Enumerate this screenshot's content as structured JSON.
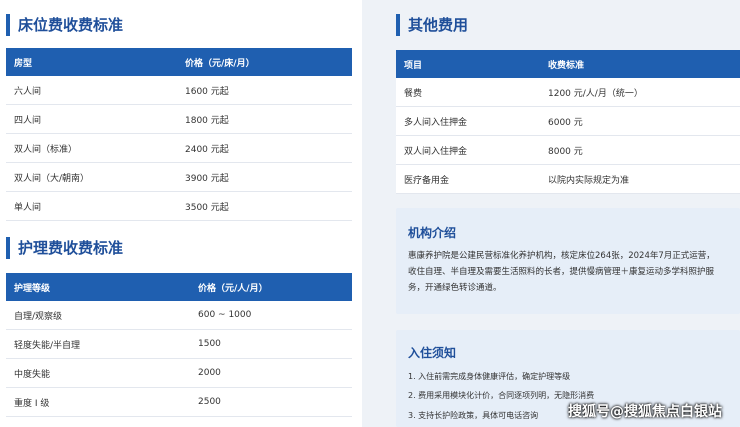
{
  "bed": {
    "title": "床位费收费标准",
    "headers": [
      "房型",
      "价格（元/床/月）"
    ],
    "rows": [
      [
        "六人间",
        "1600 元起"
      ],
      [
        "四人间",
        "1800 元起"
      ],
      [
        "双人间（标准）",
        "2400 元起"
      ],
      [
        "双人间（大/朝南）",
        "3900 元起"
      ],
      [
        "单人间",
        "3500 元起"
      ]
    ]
  },
  "care": {
    "title": "护理费收费标准",
    "headers": [
      "护理等级",
      "价格（元/人/月）"
    ],
    "rows": [
      [
        "自理/观察级",
        "600 ~ 1000"
      ],
      [
        "轻度失能/半自理",
        "1500"
      ],
      [
        "中度失能",
        "2000"
      ],
      [
        "重度 I 级",
        "2500"
      ]
    ]
  },
  "other": {
    "title": "其他费用",
    "headers": [
      "项目",
      "收费标准"
    ],
    "rows": [
      [
        "餐费",
        "1200 元/人/月（统一）"
      ],
      [
        "多人间入住押金",
        "6000 元"
      ],
      [
        "双人间入住押金",
        "8000 元"
      ],
      [
        "医疗备用金",
        "以院内实际规定为准"
      ]
    ]
  },
  "intro": {
    "title": "机构介绍",
    "lines": [
      "惠康养护院是公建民营标准化养护机构，核定床位264张，2024年7月正式运营，",
      "收住自理、半自理及需要生活照料的长者，提供慢病管理＋康复运动多学科照护服",
      "务，开通绿色转诊通道。"
    ]
  },
  "notice": {
    "title": "入住须知",
    "items": [
      "1. 入住前需完成身体健康评估，确定护理等级",
      "2. 费用采用模块化计价，合同逐项列明，无隐形消费",
      "3. 支持长护险政策，具体可电话咨询"
    ]
  },
  "watermark": "搜狐号@搜狐焦点白银站"
}
